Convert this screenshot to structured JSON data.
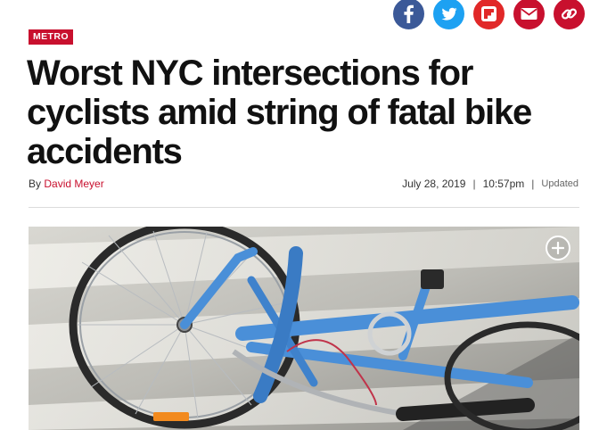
{
  "share": {
    "facebook_icon": "facebook-icon",
    "twitter_icon": "twitter-icon",
    "flipboard_icon": "flipboard-icon",
    "email_icon": "email-icon",
    "link_icon": "link-icon",
    "colors": {
      "facebook": "#3b5998",
      "twitter": "#1da1f2",
      "flipboard": "#e12828",
      "email": "#c8102e",
      "link": "#c8102e"
    }
  },
  "article": {
    "section": "METRO",
    "headline": "Worst NYC intersections for cyclists amid string of fatal bike accidents",
    "byline_prefix": "By",
    "author": "David Meyer",
    "date": "July 28, 2019",
    "time": "10:57pm",
    "separator": "|",
    "updated_label": "Updated"
  },
  "hero": {
    "expand_icon": "plus-icon"
  },
  "colors": {
    "accent": "#c8102e",
    "text": "#111111"
  }
}
